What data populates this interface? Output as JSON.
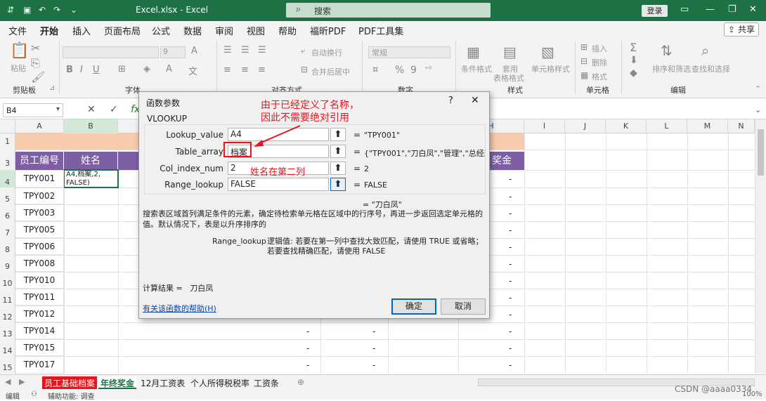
{
  "window": {
    "title": "Excel.xlsx  -  Excel",
    "search_placeholder": "搜索",
    "login_label": "登录",
    "share_label": "共享"
  },
  "menu": [
    "文件",
    "开始",
    "插入",
    "页面布局",
    "公式",
    "数据",
    "审阅",
    "视图",
    "帮助",
    "福昕PDF",
    "PDF工具集"
  ],
  "ribbon": {
    "groups": [
      "剪贴板",
      "字体",
      "对齐方式",
      "数字",
      "样式",
      "单元格",
      "编辑"
    ],
    "paste": "粘贴",
    "wrap": "自动换行",
    "merge": "合并后居中",
    "number_format": "常规",
    "cond_format": "条件格式",
    "table_format_1": "套用",
    "table_format_2": "表格格式",
    "cell_style": "单元格样式",
    "insert": "插入",
    "delete": "删除",
    "format": "格式",
    "sort_filter": "排序和筛选",
    "find_select": "查找和选择",
    "font_size": "9"
  },
  "formula_bar": {
    "name_box": "B4",
    "fx": "fx"
  },
  "sheet": {
    "columns": [
      "A",
      "B",
      "H",
      "I",
      "J",
      "K",
      "L",
      "M",
      "N"
    ],
    "rows": [
      "1",
      "3",
      "4",
      "5",
      "6",
      "7",
      "8",
      "9",
      "10",
      "11",
      "12",
      "13",
      "14",
      "15"
    ],
    "header_a": "员工编号",
    "header_b": "姓名",
    "header_h": "奖金",
    "active_cell_text": "A4,档案,2,\nFALSE)",
    "ids": [
      "TPY001",
      "TPY002",
      "TPY003",
      "TPY005",
      "TPY006",
      "TPY008",
      "TPY010",
      "TPY011",
      "TPY012",
      "TPY014",
      "TPY015",
      "TPY017"
    ],
    "dash": "-"
  },
  "dialog": {
    "title": "函数参数",
    "help": "?",
    "close": "✕",
    "function": "VLOOKUP",
    "args": [
      {
        "label": "Lookup_value",
        "input": "A4",
        "value": "\"TPY001\""
      },
      {
        "label": "Table_array",
        "input": "档案",
        "value": "{\"TPY001\",\"刀白凤\",\"管理\",\"总经理\",\""
      },
      {
        "label": "Col_index_num",
        "input": "2",
        "value": "2"
      },
      {
        "label": "Range_lookup",
        "input": "FALSE",
        "value": "FALSE"
      }
    ],
    "result": "= \"刀白凤\"",
    "description": "搜索表区域首列满足条件的元素，确定待检索单元格在区域中的行序号，再进一步返回选定单元格的值。默认情况下，表是以升序排序的",
    "param_name": "Range_lookup",
    "param_desc": "逻辑值: 若要在第一列中查找大致匹配，请使用 TRUE 或省略；若要查找精确匹配，请使用 FALSE",
    "calc_label": "计算结果 =",
    "calc_value": "刀白凤",
    "help_link": "有关该函数的帮助(H)",
    "ok": "确定",
    "cancel": "取消"
  },
  "annotations": {
    "note1_line1": "由于已经定义了名称，",
    "note1_line2": "因此不需要绝对引用",
    "note2": "姓名在第二列"
  },
  "sheet_tabs": [
    "员工基础档案",
    "年终奖金",
    "12月工资表",
    "个人所得税税率",
    "工资条"
  ],
  "status": {
    "mode": "编辑",
    "accessibility": "辅助功能: 调查",
    "watermark": "CSDN @aaaa0334",
    "zoom": "100%"
  },
  "colors": {
    "excel_green": "#1e7145",
    "header_purple": "#7e5ea4",
    "title_orange": "#f8cbad",
    "annotation_red": "#e8141c"
  }
}
